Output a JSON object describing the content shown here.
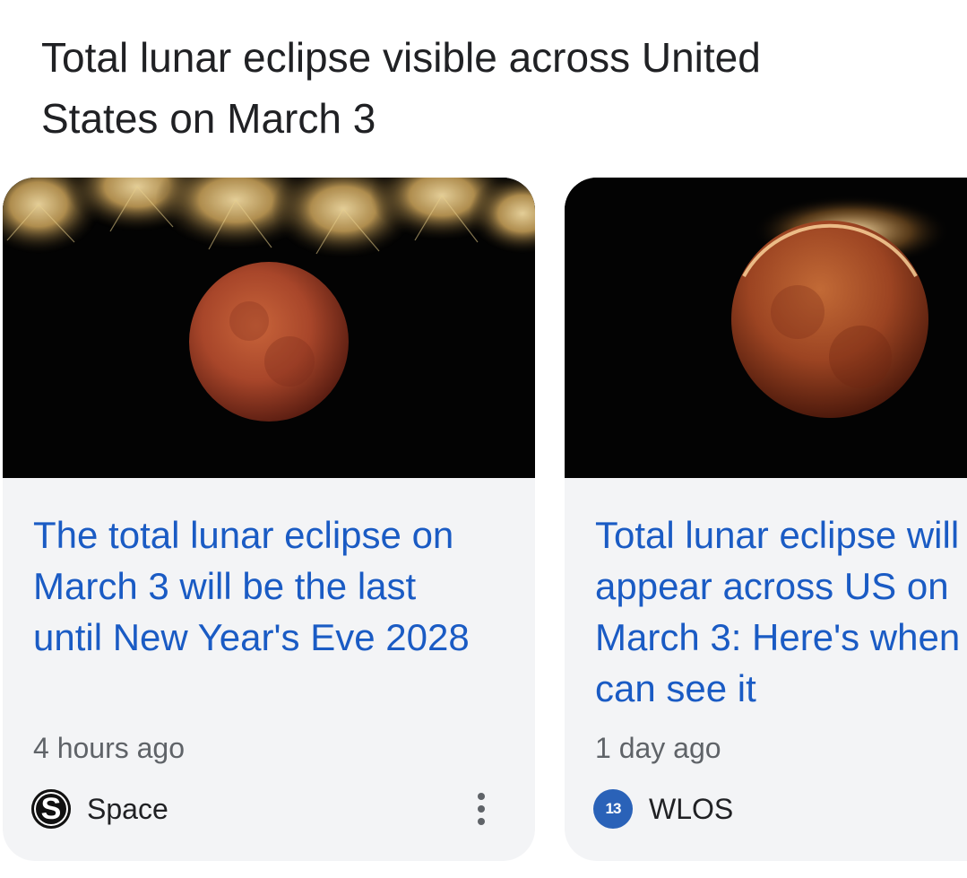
{
  "heading": {
    "line1": "Total lunar eclipse visible across United",
    "line2": "States on March 3"
  },
  "cards": [
    {
      "title_lines": [
        "The total lunar eclipse on",
        "March 3 will be the last",
        "until New Year's Eve 2028"
      ],
      "time": "4 hours ago",
      "source": "Space",
      "source_logo_letter": "S",
      "image_icon": "blood-moon-with-fireworks",
      "menu_icon": "more-vert-icon"
    },
    {
      "title_lines": [
        "Total lunar eclipse will",
        "appear across US on",
        "March 3: Here's when",
        "can see it"
      ],
      "time": "1 day ago",
      "source": "WLOS",
      "source_logo_letter": "13",
      "image_icon": "blood-moon-eclipse"
    }
  ],
  "colors": {
    "title_link": "#1a5bc4",
    "card_bg": "#f3f4f6",
    "meta_text": "#5f6368",
    "wlos_logo": "#2a62b8"
  }
}
